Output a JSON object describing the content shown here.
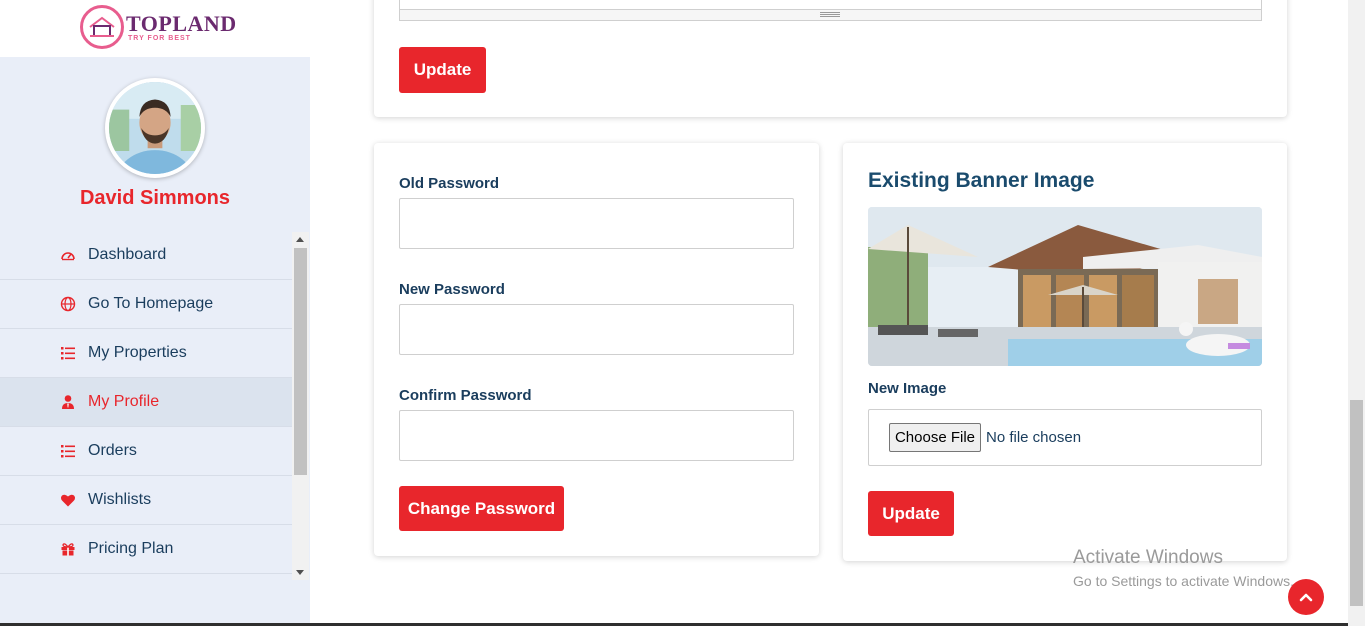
{
  "brand": {
    "name": "TOPLAND",
    "tagline": "TRY FOR BEST"
  },
  "user": {
    "name": "David Simmons"
  },
  "sidebar": {
    "items": [
      {
        "label": "Dashboard",
        "icon": "dashboard-gauge-icon",
        "active": false
      },
      {
        "label": "Go To Homepage",
        "icon": "globe-icon",
        "active": false
      },
      {
        "label": "My Properties",
        "icon": "list-icon",
        "active": false
      },
      {
        "label": "My Profile",
        "icon": "user-tie-icon",
        "active": true
      },
      {
        "label": "Orders",
        "icon": "list-icon",
        "active": false
      },
      {
        "label": "Wishlists",
        "icon": "heart-icon",
        "active": false
      },
      {
        "label": "Pricing Plan",
        "icon": "gift-icon",
        "active": false
      }
    ]
  },
  "top_card": {
    "update_label": "Update"
  },
  "password_form": {
    "old_label": "Old Password",
    "old_value": "",
    "new_label": "New Password",
    "new_value": "",
    "confirm_label": "Confirm Password",
    "confirm_value": "",
    "submit_label": "Change Password"
  },
  "banner_form": {
    "title": "Existing Banner Image",
    "new_image_label": "New Image",
    "choose_file_label": "Choose File",
    "no_file_text": "No file chosen",
    "update_label": "Update"
  },
  "os_watermark": {
    "line1": "Activate Windows",
    "line2": "Go to Settings to activate Windows."
  },
  "colors": {
    "accent": "#e8262c",
    "heading": "#1a3d5d",
    "sidebar_bg": "#e9eef8",
    "brand_purple": "#6b2a6f",
    "brand_pink": "#e85d8e"
  }
}
